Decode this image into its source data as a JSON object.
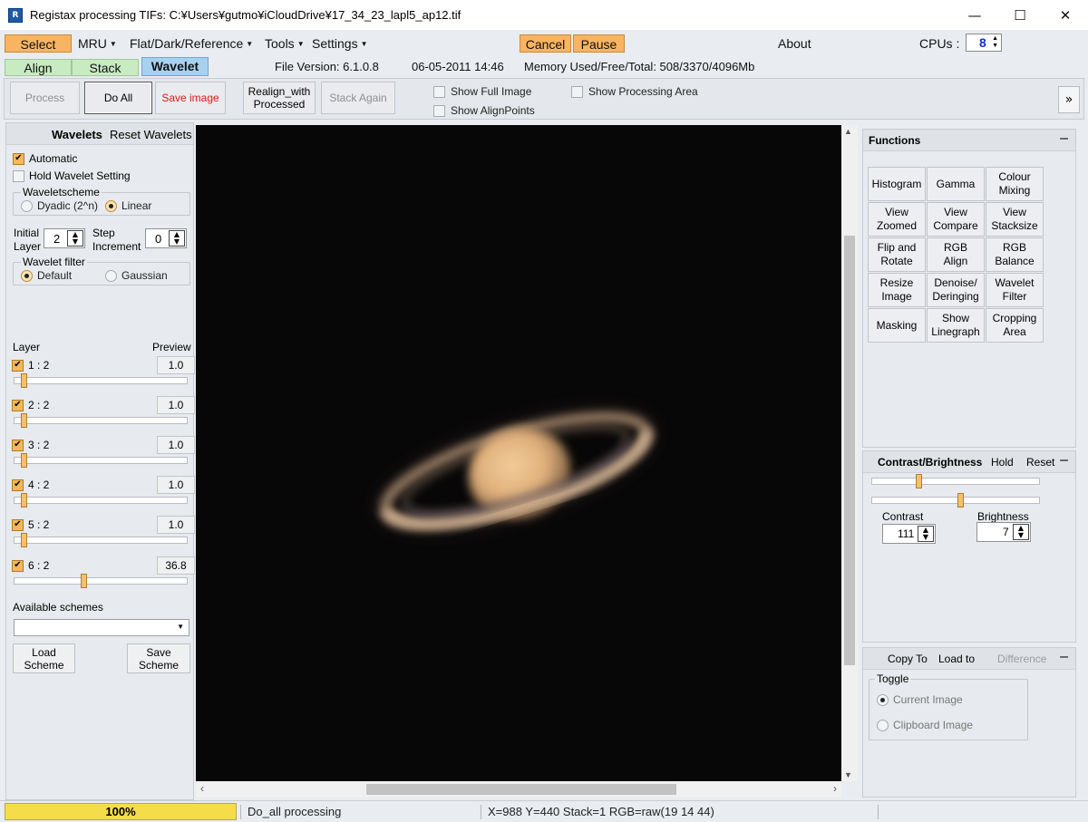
{
  "window": {
    "title": "Registax processing TIFs: C:¥Users¥gutmo¥iCloudDrive¥17_34_23_lapl5_ap12.tif",
    "icon_text": "R",
    "controls": {
      "minimize": "—",
      "maximize": "☐",
      "close": "✕"
    }
  },
  "menu": {
    "select": "Select",
    "mru": "MRU",
    "flat": "Flat/Dark/Reference",
    "tools": "Tools",
    "settings": "Settings",
    "cancel": "Cancel",
    "pause": "Pause",
    "about": "About",
    "cpus_label": "CPUs :",
    "cpus_value": "8",
    "caret": "▼"
  },
  "tabs": {
    "align": "Align",
    "stack": "Stack",
    "wavelet": "Wavelet"
  },
  "info": {
    "version": "File Version: 6.1.0.8",
    "date": "06-05-2011 14:46",
    "memory": "Memory Used/Free/Total: 508/3370/4096Mb"
  },
  "toolbar": {
    "process": "Process",
    "do_all": "Do All",
    "save_image": "Save image",
    "realign_1": "Realign_with",
    "realign_2": "Processed",
    "stack_again": "Stack Again",
    "show_full_image": "Show Full Image",
    "show_alignpoints": "Show AlignPoints",
    "show_processing_area": "Show Processing Area",
    "expand": "»"
  },
  "wavelets": {
    "header": "Wavelets",
    "reset": "Reset Wavelets",
    "automatic": "Automatic",
    "hold": "Hold Wavelet Setting",
    "scheme_title": "Waveletscheme",
    "dyadic": "Dyadic (2^n)",
    "linear": "Linear",
    "initial_1": "Initial",
    "initial_2": "Layer",
    "initial_value": "2",
    "step_1": "Step",
    "step_2": "Increment",
    "step_value": "0",
    "filter_title": "Wavelet filter",
    "default": "Default",
    "gaussian": "Gaussian",
    "layer_label": "Layer",
    "preview_label": "Preview",
    "layers": [
      {
        "label": "1 : 2",
        "value": "1.0",
        "level": 0.04
      },
      {
        "label": "2 : 2",
        "value": "1.0",
        "level": 0.04
      },
      {
        "label": "3 : 2",
        "value": "1.0",
        "level": 0.04
      },
      {
        "label": "4 : 2",
        "value": "1.0",
        "level": 0.04
      },
      {
        "label": "5 : 2",
        "value": "1.0",
        "level": 0.04
      },
      {
        "label": "6 : 2",
        "value": "36.8",
        "level": 0.4
      }
    ],
    "available_schemes": "Available schemes",
    "load_1": "Load",
    "load_2": "Scheme",
    "save_1": "Save",
    "save_2": "Scheme"
  },
  "functions": {
    "header": "Functions",
    "collapse": "–",
    "buttons": [
      [
        "Histogram"
      ],
      [
        "Gamma"
      ],
      [
        "Colour",
        "Mixing"
      ],
      [
        "View",
        "Zoomed"
      ],
      [
        "View",
        "Compare"
      ],
      [
        "View",
        "Stacksize"
      ],
      [
        "Flip and",
        "Rotate"
      ],
      [
        "RGB",
        "Align"
      ],
      [
        "RGB",
        "Balance"
      ],
      [
        "Resize",
        "Image"
      ],
      [
        "Denoise/",
        "Deringing"
      ],
      [
        "Wavelet",
        "Filter"
      ],
      [
        "Masking"
      ],
      [
        "Show",
        "Linegraph"
      ],
      [
        "Cropping",
        "Area"
      ]
    ]
  },
  "contrast": {
    "header": "Contrast/Brightness",
    "hold": "Hold",
    "reset": "Reset",
    "collapse": "–",
    "contrast_label": "Contrast",
    "contrast_value": "111",
    "contrast_level": 0.27,
    "brightness_label": "Brightness",
    "brightness_value": "7",
    "brightness_level": 0.53
  },
  "copy": {
    "copy_to": "Copy To",
    "load_to": "Load to",
    "difference": "Difference",
    "collapse": "–",
    "toggle": "Toggle",
    "current_image": "Current Image",
    "clipboard_image": "Clipboard Image"
  },
  "status": {
    "progress": "100%",
    "progress_fraction": 1.0,
    "message": "Do_all processing",
    "coords": "X=988 Y=440 Stack=1 RGB=raw(19 14 44)"
  },
  "colors": {
    "accent_orange": "#f9b461",
    "tab_green": "#c9ebc2",
    "tab_blue": "#a6d2f0",
    "image_background": "#080707"
  }
}
